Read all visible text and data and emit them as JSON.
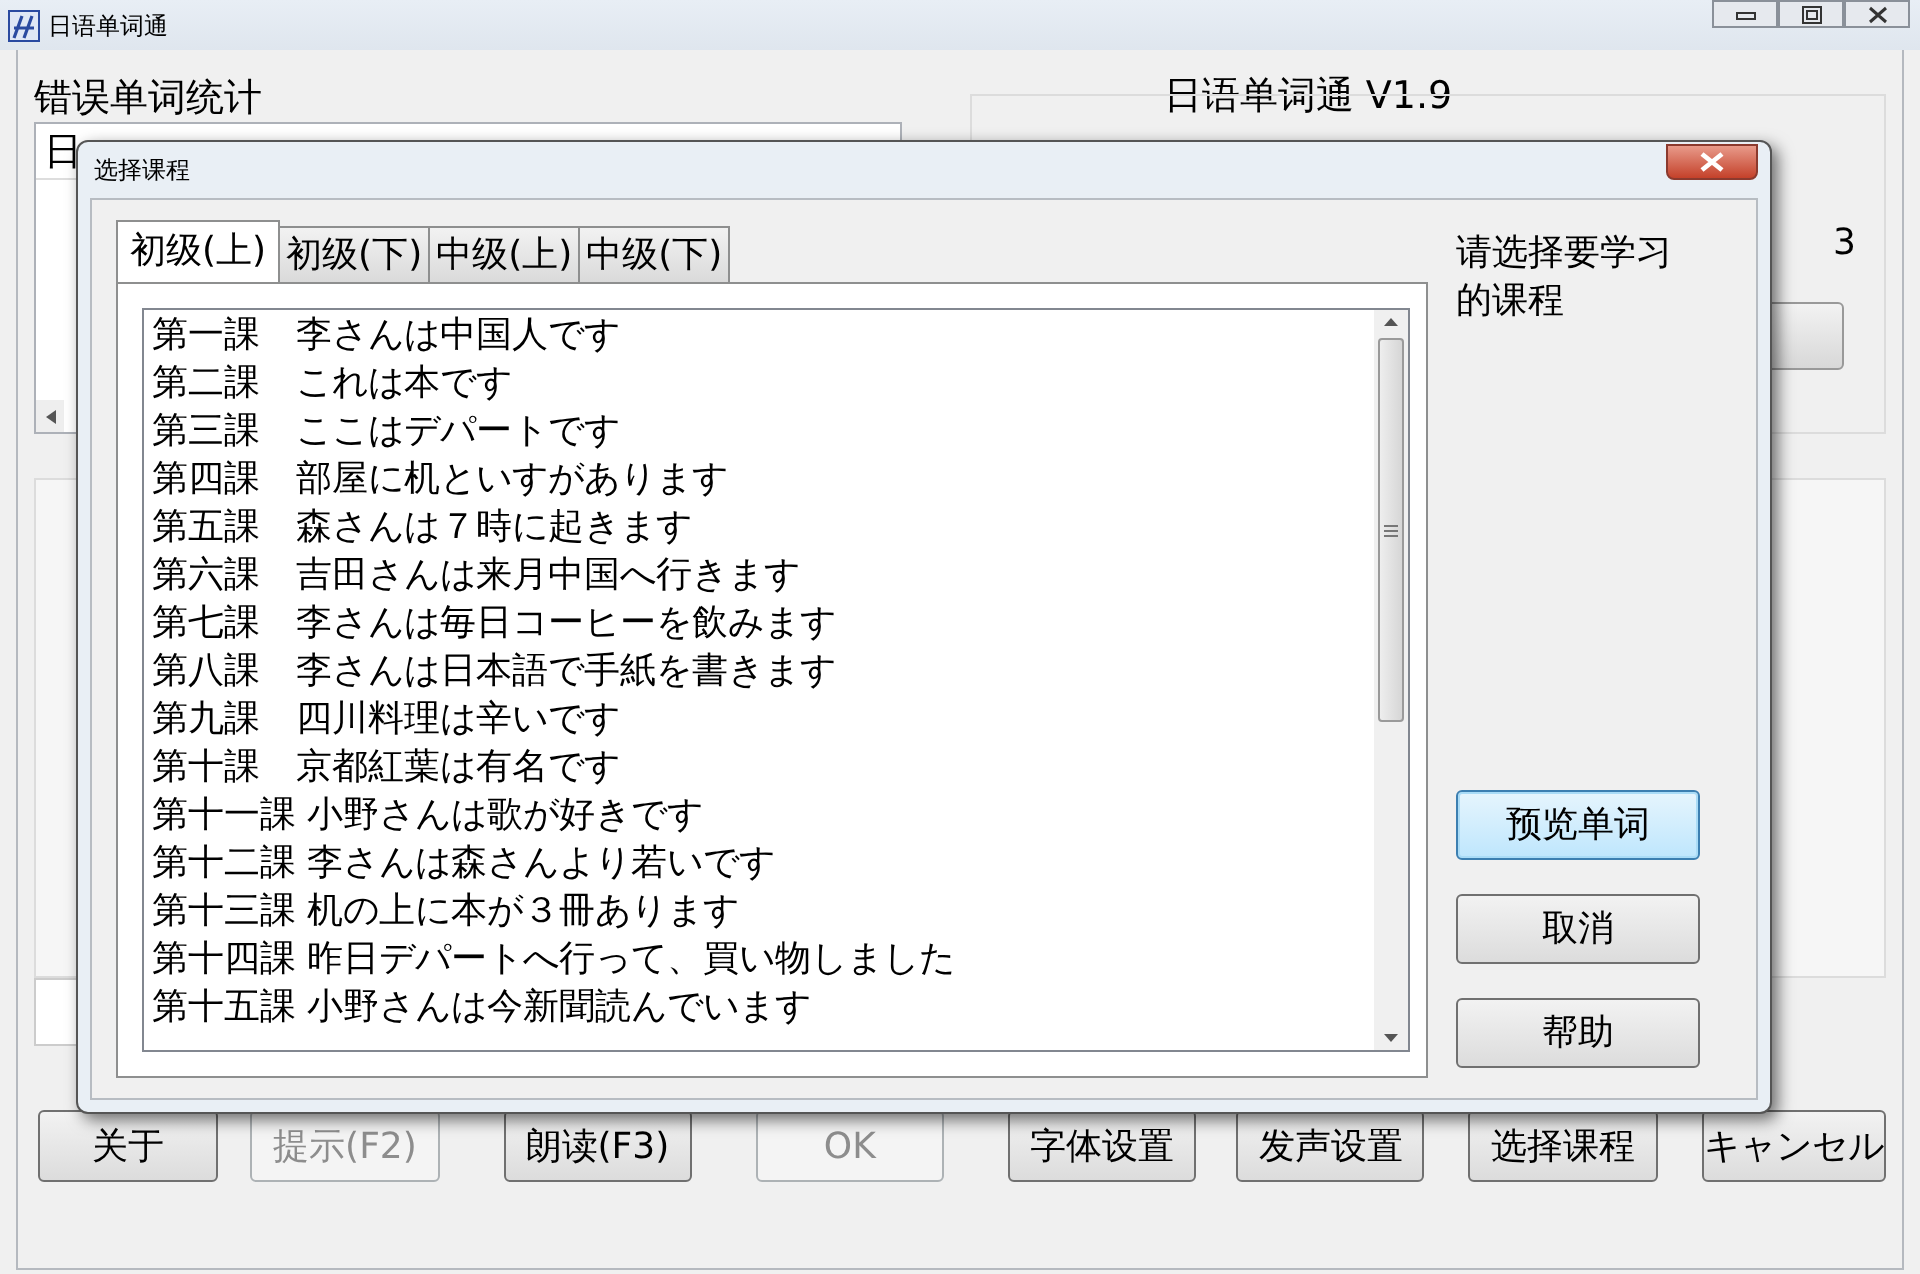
{
  "window": {
    "title": "日语单词通"
  },
  "main": {
    "stats_title": "错误单词统计",
    "stats_table": {
      "column_1": "日"
    },
    "app_title": "日语单词通 V1.9",
    "count": "3"
  },
  "buttons": [
    {
      "label": "关于",
      "disabled": false
    },
    {
      "label": "提示(F2)",
      "disabled": true
    },
    {
      "label": "朗读(F3)",
      "disabled": false
    },
    {
      "label": "OK",
      "disabled": true
    },
    {
      "label": "字体设置",
      "disabled": false
    },
    {
      "label": "发声设置",
      "disabled": false
    },
    {
      "label": "选择课程",
      "disabled": false
    },
    {
      "label": "キャンセル",
      "disabled": false
    }
  ],
  "dialog": {
    "title": "选择课程",
    "tabs": [
      {
        "label": "初级(上)",
        "selected": true
      },
      {
        "label": "初级(下)",
        "selected": false
      },
      {
        "label": "中级(上)",
        "selected": false
      },
      {
        "label": "中级(下)",
        "selected": false
      }
    ],
    "lessons": [
      "第一課　李さんは中国人です",
      "第二課　これは本です",
      "第三課　ここはデパートです",
      "第四課　部屋に机といすがあります",
      "第五課　森さんは７時に起きます",
      "第六課　吉田さんは来月中国へ行きます",
      "第七課　李さんは毎日コーヒーを飲みます",
      "第八課　李さんは日本語で手紙を書きます",
      "第九課　四川料理は辛いです",
      "第十課　京都紅葉は有名です",
      "第十一課 小野さんは歌が好きです",
      "第十二課 李さんは森さんより若いです",
      "第十三課 机の上に本が３冊あります",
      "第十四課 昨日デパートへ行って、買い物しました",
      "第十五課 小野さんは今新聞読んでいます"
    ],
    "hint": "请选择要学习的课程",
    "buttons": [
      {
        "label": "预览单词",
        "default": true
      },
      {
        "label": "取消",
        "default": false
      },
      {
        "label": "帮助",
        "default": false
      }
    ]
  }
}
